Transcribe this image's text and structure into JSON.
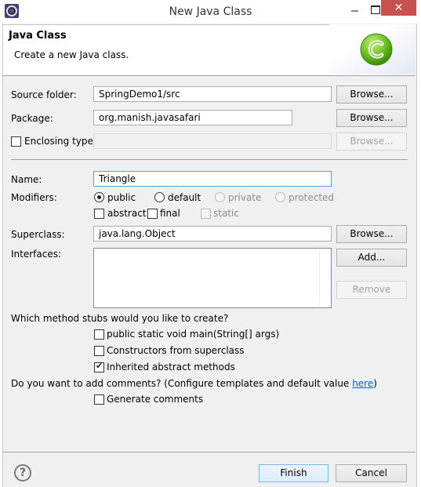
{
  "window": {
    "title": "New Java Class",
    "app_icon": "eclipse-gear-icon",
    "minimize_icon": "minimize-icon",
    "maximize_icon": "maximize-icon",
    "close_glyph": "✕"
  },
  "header": {
    "title": "Java Class",
    "description": "Create a new Java class.",
    "icon": "java-class-c-icon",
    "icon_glyph": "C"
  },
  "form": {
    "source_folder": {
      "label": "Source folder:",
      "value": "SpringDemo1/src",
      "browse": "Browse..."
    },
    "package": {
      "label": "Package:",
      "value": "org.manish.javasafari",
      "browse": "Browse..."
    },
    "enclosing_type": {
      "label": "Enclosing type:",
      "checked": false,
      "value": "",
      "browse": "Browse..."
    },
    "name": {
      "label": "Name:",
      "value": "Triangle"
    },
    "modifiers": {
      "label": "Modifiers:",
      "access": [
        {
          "label": "public",
          "selected": true,
          "enabled": true
        },
        {
          "label": "default",
          "selected": false,
          "enabled": true
        },
        {
          "label": "private",
          "selected": false,
          "enabled": false
        },
        {
          "label": "protected",
          "selected": false,
          "enabled": false
        }
      ],
      "flags": [
        {
          "label": "abstract",
          "checked": false,
          "enabled": true
        },
        {
          "label": "final",
          "checked": false,
          "enabled": true
        },
        {
          "label": "static",
          "checked": false,
          "enabled": false
        }
      ]
    },
    "superclass": {
      "label": "Superclass:",
      "value": "java.lang.Object",
      "browse": "Browse..."
    },
    "interfaces": {
      "label": "Interfaces:",
      "items": [],
      "add": "Add...",
      "remove": "Remove"
    },
    "stubs": {
      "question": "Which method stubs would you like to create?",
      "options": [
        {
          "label": "public static void main(String[] args)",
          "checked": false
        },
        {
          "label": "Constructors from superclass",
          "checked": false
        },
        {
          "label": "Inherited abstract methods",
          "checked": true
        }
      ]
    },
    "comments": {
      "question_prefix": "Do you want to add comments? (Configure templates and default value ",
      "link": "here",
      "question_suffix": ")",
      "option": {
        "label": "Generate comments",
        "checked": false
      }
    }
  },
  "footer": {
    "help_glyph": "?",
    "finish": "Finish",
    "cancel": "Cancel"
  },
  "colors": {
    "close_button": "#c75050",
    "dialog_bg": "#f0f0f0",
    "link": "#0066cc",
    "default_button_border": "#7eb4ea",
    "java_icon_green": "#6abf1f"
  }
}
